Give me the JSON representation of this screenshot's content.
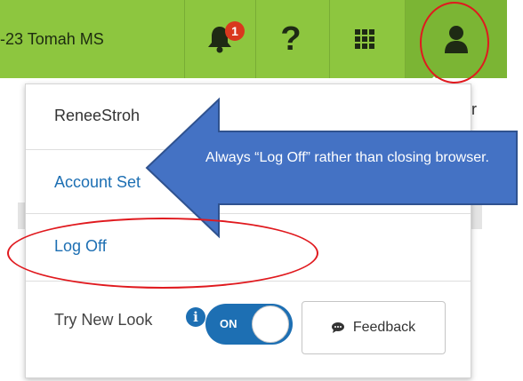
{
  "header": {
    "school_label": "-23 Tomah MS",
    "notification_count": "1"
  },
  "menu": {
    "username": "ReneeStroh",
    "account_settings": "Account Set",
    "log_off": "Log Off",
    "try_new_look": "Try New Look",
    "toggle_state": "ON",
    "feedback": "Feedback"
  },
  "background": {
    "partial_text": "r"
  },
  "annotation": {
    "callout_text": "Always “Log Off” rather than closing browser."
  },
  "icons": {
    "bell": "bell-icon",
    "help": "question-icon",
    "apps": "grid-icon",
    "user": "user-icon",
    "info": "info-icon",
    "feedback": "chat-bubble-icon"
  },
  "colors": {
    "topbar": "#8dc63f",
    "link": "#1d6fb3",
    "badge": "#d9381e",
    "annotation_red": "#e0191e",
    "callout_blue": "#4472c4"
  }
}
